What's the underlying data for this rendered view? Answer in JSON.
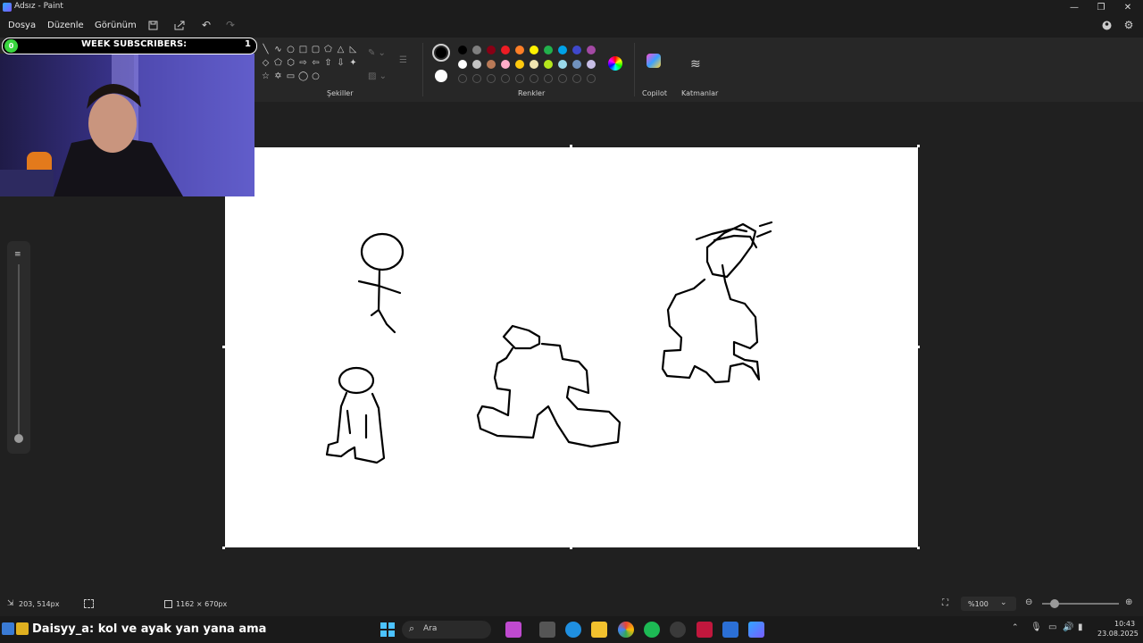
{
  "window": {
    "title": "Adsız - Paint"
  },
  "menu": {
    "file": "Dosya",
    "edit": "Düzenle",
    "view": "Görünüm"
  },
  "ribbon": {
    "shapes_label": "Şekiller",
    "colors_label": "Renkler",
    "copilot_label": "Copilot",
    "layers_label": "Katmanlar",
    "palette_row1": [
      "#000000",
      "#7f7f7f",
      "#880015",
      "#ed1c24",
      "#ff7f27",
      "#fff200",
      "#22b14c",
      "#00a2e8",
      "#3f48cc",
      "#a349a4"
    ],
    "palette_row2": [
      "#ffffff",
      "#c3c3c3",
      "#b97a57",
      "#ffaec9",
      "#ffc90e",
      "#efe4b0",
      "#b5e61d",
      "#99d9ea",
      "#7092be",
      "#c8bfe7"
    ]
  },
  "overlay": {
    "sub_count_left": "0",
    "subscribers_label": "WEEK SUBSCRIBERS:",
    "sub_count_right": "1"
  },
  "status": {
    "cursor_pos": "203, 514px",
    "canvas_size": "1162 × 670px",
    "zoom": "%100"
  },
  "taskbar": {
    "search_placeholder": "Ara",
    "time": "10:43",
    "date": "23.08.2025"
  },
  "chat": {
    "username": "Daisyy_a",
    "message": ": kol ve ayak yan yana ama"
  }
}
